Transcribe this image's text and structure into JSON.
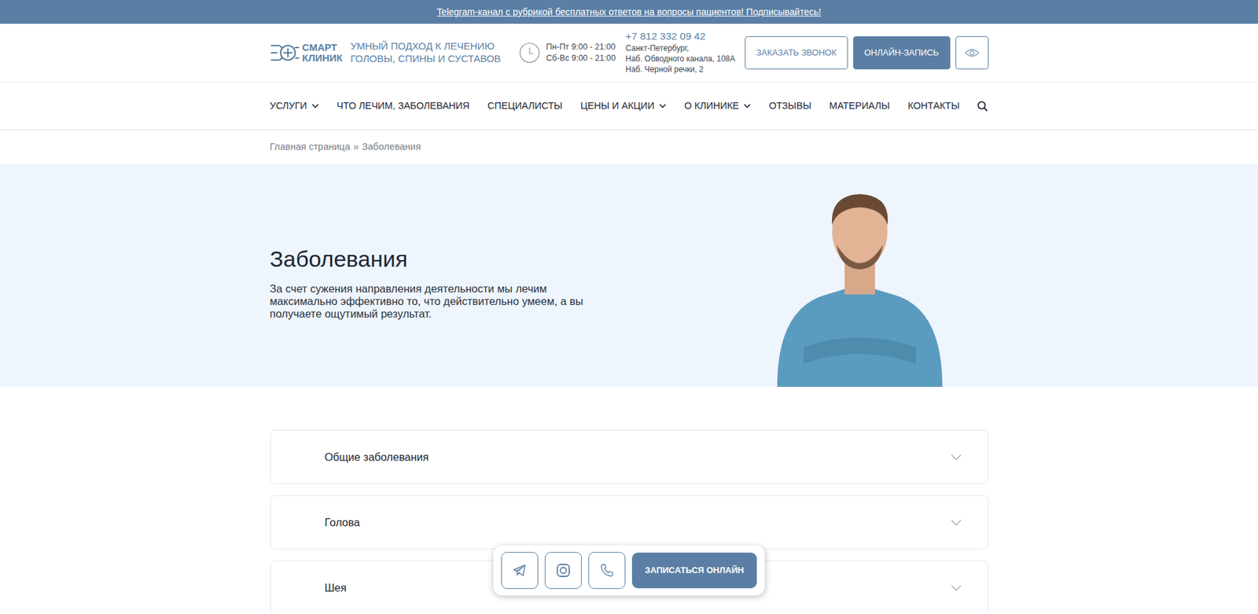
{
  "banner": {
    "text": "Telegram-канал с рубрикой бесплатных ответов на вопросы пациентов! Подписывайтесь!"
  },
  "header": {
    "logo": [
      "СМАРТ",
      "КЛИНИК"
    ],
    "tagline": [
      "УМНЫЙ ПОДХОД К ЛЕЧЕНИЮ",
      "ГОЛОВЫ, СПИНЫ И СУСТАВОВ"
    ],
    "hours": [
      "Пн-Пт 9:00 - 21:00",
      "Сб-Вс 9:00 - 21:00"
    ],
    "phone": "+7 812 332 09 42",
    "address": [
      "Санкт-Петербург,",
      "Наб. Обводного канала, 108А",
      "Наб. Черной речки, 2"
    ],
    "buttons": [
      "ЗАКАЗАТЬ ЗВОНОК",
      "ОНЛАЙН-ЗАПИСЬ"
    ]
  },
  "nav": [
    {
      "label": "УСЛУГИ",
      "dropdown": true
    },
    {
      "label": "ЧТО ЛЕЧИМ, ЗАБОЛЕВАНИЯ",
      "dropdown": false
    },
    {
      "label": "СПЕЦИАЛИСТЫ",
      "dropdown": false
    },
    {
      "label": "ЦЕНЫ И АКЦИИ",
      "dropdown": true
    },
    {
      "label": "О КЛИНИКЕ",
      "dropdown": true
    },
    {
      "label": "ОТЗЫВЫ",
      "dropdown": false
    },
    {
      "label": "МАТЕРИАЛЫ",
      "dropdown": false
    },
    {
      "label": "КОНТАКТЫ",
      "dropdown": false
    }
  ],
  "breadcrumb": {
    "separator": "»",
    "items": [
      {
        "label": "Главная страница",
        "current": false
      },
      {
        "label": "Заболевания",
        "current": true
      }
    ]
  },
  "hero": {
    "title": "Заболевания",
    "text": "За счет сужения направления деятельности мы лечим максимально эффективно то, что действительно умеем, а вы получаете ощутимый результат."
  },
  "accordion": [
    {
      "label": "Общие заболевания",
      "expanded": false
    },
    {
      "label": "Голова",
      "expanded": false
    },
    {
      "label": "Шея",
      "expanded": false
    }
  ],
  "floating_bar": {
    "button": "ЗАПИСАТЬСЯ ОНЛАЙН"
  }
}
